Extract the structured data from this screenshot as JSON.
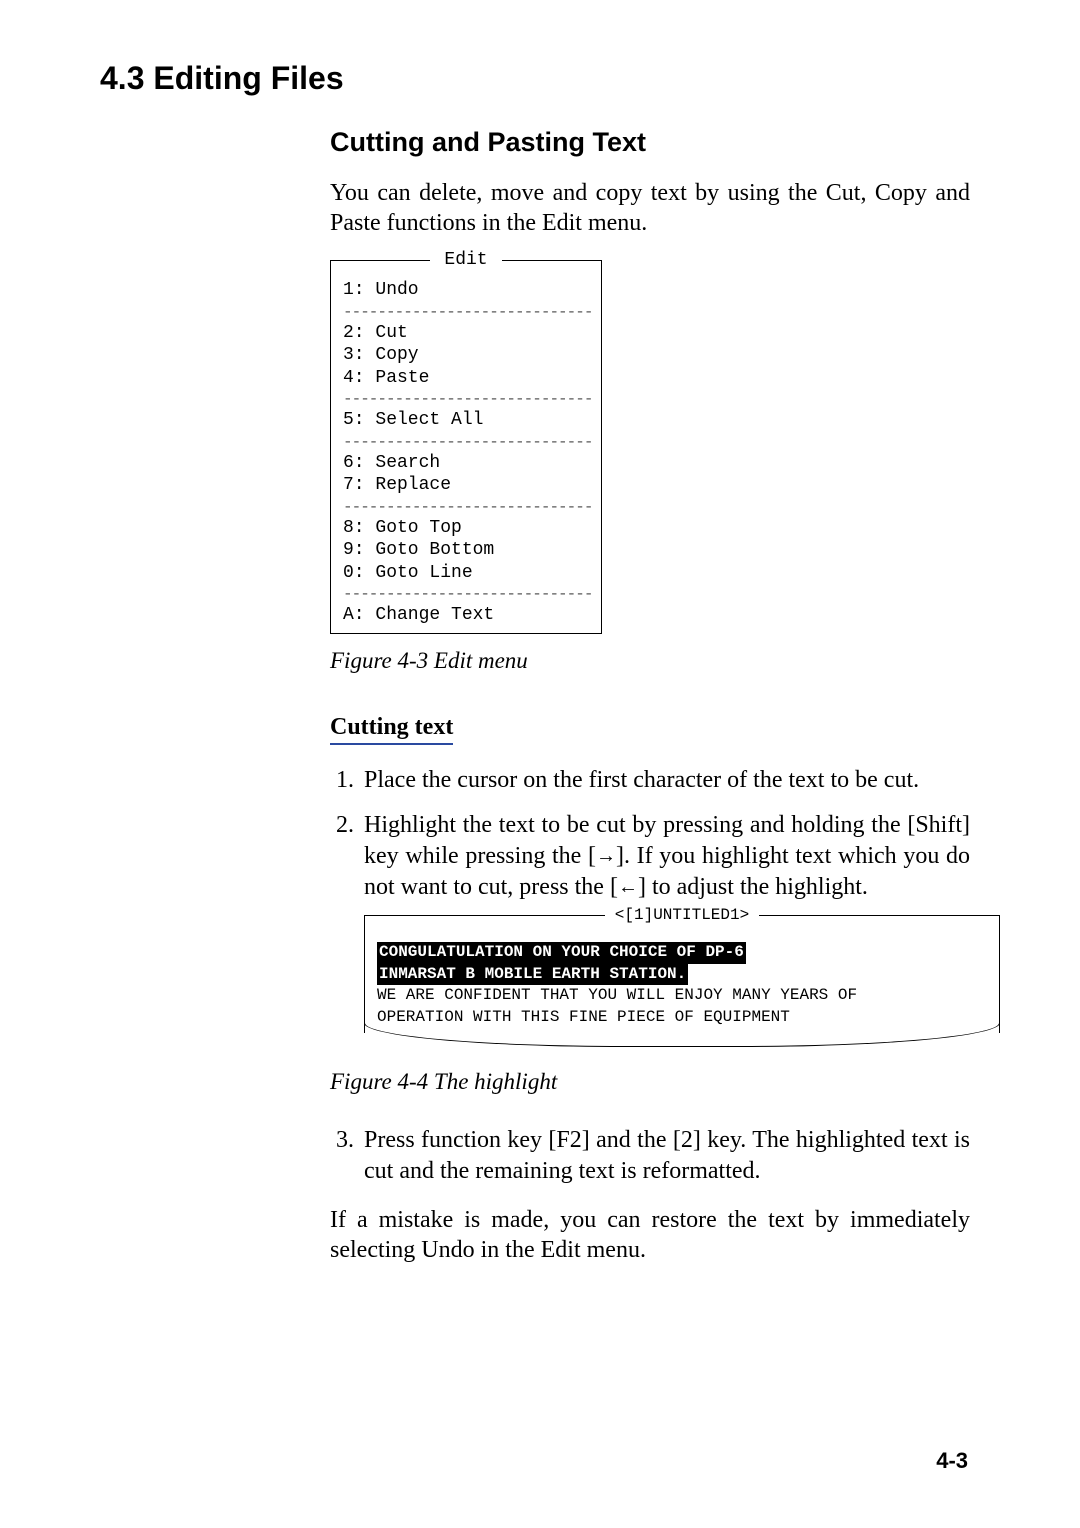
{
  "section_title": "4.3 Editing Files",
  "subsection_title": "Cutting and Pasting Text",
  "intro_text": "You can delete, move and copy text by using the Cut, Copy and Paste functions in the Edit menu.",
  "edit_menu": {
    "legend": "Edit",
    "groups": [
      [
        "1: Undo"
      ],
      [
        "2: Cut",
        "3: Copy",
        "4: Paste"
      ],
      [
        "5: Select All"
      ],
      [
        "6: Search",
        "7: Replace"
      ],
      [
        "8: Goto Top",
        "9: Goto Bottom",
        "0: Goto Line"
      ],
      [
        "A: Change Text"
      ]
    ]
  },
  "figure_43_caption": "Figure 4-3 Edit menu",
  "cutting_heading": "Cutting text",
  "steps_part1": {
    "s1": "Place the cursor on the first character of the text to be cut.",
    "s2a": "Highlight the text to be cut by pressing and holding the [Shift] key while pressing the [",
    "s2_arrow_right": "→",
    "s2b": "]. If you highlight text which you do not want to cut, press the [",
    "s2_arrow_left": "←",
    "s2c": "] to adjust the highlight."
  },
  "editor": {
    "legend": "<[1]UNTITLED1>",
    "hl_line1": "CONGULATULATION ON YOUR CHOICE OF DP-6",
    "hl_line2": "INMARSAT B MOBILE EARTH STATION.",
    "plain_line3": "WE ARE CONFIDENT THAT YOU WILL ENJOY MANY YEARS OF",
    "plain_line4": "OPERATION WITH THIS FINE PIECE OF EQUIPMENT"
  },
  "figure_44_caption": "Figure 4-4 The highlight",
  "steps_part2": {
    "s3": "Press function key [F2] and the [2] key. The highlighted text is cut and the remaining text is reformatted."
  },
  "closing_text": "If a mistake is made, you can restore the text by immediately selecting Undo in the Edit menu.",
  "page_number": "4-3"
}
